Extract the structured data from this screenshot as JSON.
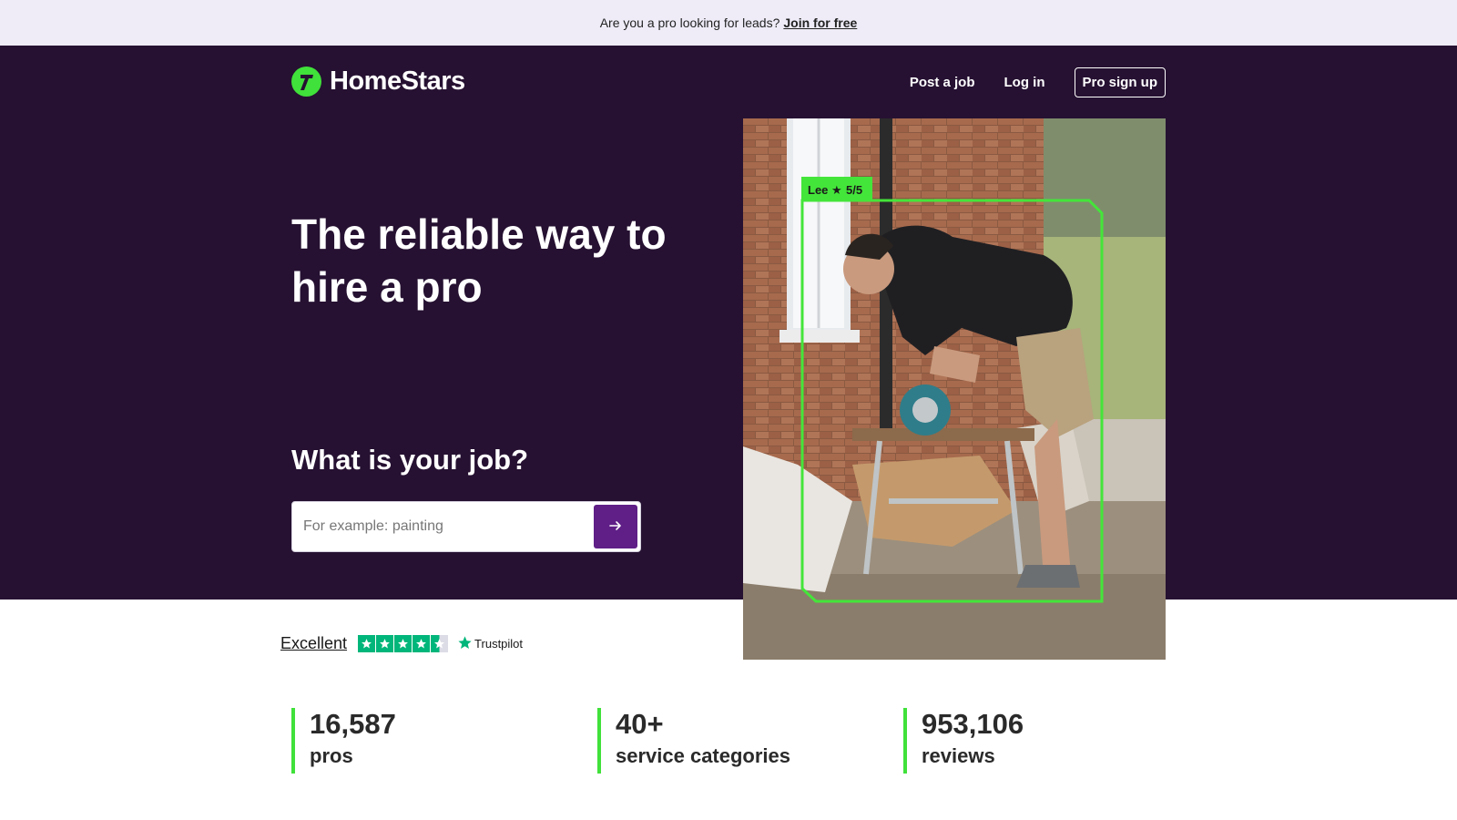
{
  "promo": {
    "text": "Are you a pro looking for leads?",
    "link": "Join for free"
  },
  "brand": {
    "name": "HomeStars",
    "logo_icon": "hammer-logo-icon",
    "accent": "#40e13a",
    "hero_bg": "#261132",
    "button_bg": "#5f1f87"
  },
  "nav": {
    "post_job": "Post a job",
    "login": "Log in",
    "pro_signup": "Pro sign up"
  },
  "hero": {
    "headline": "The reliable way to hire a pro",
    "job_question": "What is your job?"
  },
  "search": {
    "placeholder": "For example: painting",
    "value": "",
    "submit_icon": "arrow-right-icon"
  },
  "photo": {
    "tag_name": "Lee",
    "tag_rating": "5/5"
  },
  "trustpilot": {
    "rating_text": "Excellent",
    "stars": 4.5,
    "brand": "Trustpilot"
  },
  "stats": [
    {
      "value": "16,587",
      "label": "pros"
    },
    {
      "value": "40+",
      "label": "service categories"
    },
    {
      "value": "953,106",
      "label": "reviews"
    }
  ]
}
